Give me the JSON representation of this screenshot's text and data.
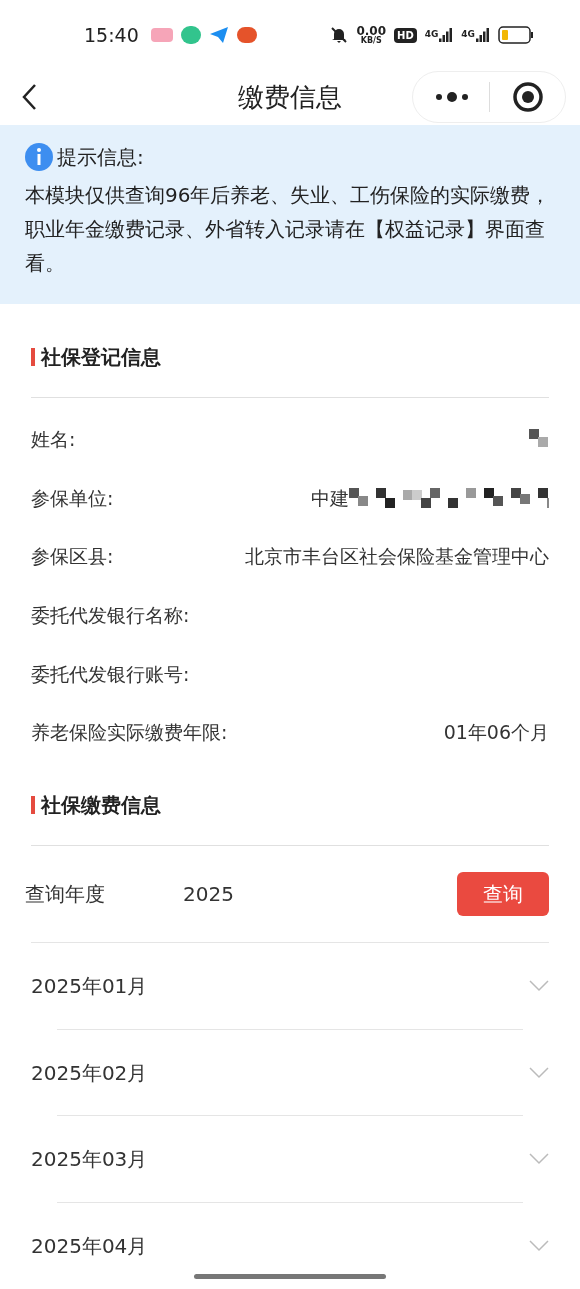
{
  "status_bar": {
    "time": "15:40",
    "speed": "0.00",
    "speed_unit": "KB/S",
    "hd": "HD",
    "networks": [
      "4G",
      "4G"
    ]
  },
  "header": {
    "title": "缴费信息"
  },
  "notice": {
    "title": "提示信息:",
    "text": "本模块仅供查询96年后养老、失业、工伤保险的实际缴费，职业年金缴费记录、外省转入记录请在【权益记录】界面查看。"
  },
  "registration": {
    "title": "社保登记信息",
    "rows": [
      {
        "label": "姓名:",
        "redacted": true
      },
      {
        "label": "参保单位:",
        "value": "中建",
        "redacted": true
      },
      {
        "label": "参保区县:",
        "value": "北京市丰台区社会保险基金管理中心",
        "redacted": false
      },
      {
        "label": "委托代发银行名称:",
        "redacted": false
      },
      {
        "label": "委托代发银行账号:",
        "redacted": false
      },
      {
        "label": "养老保险实际缴费年限:",
        "value": "01年06个月",
        "redacted": false
      }
    ]
  },
  "payment": {
    "title": "社保缴费信息",
    "query_label": "查询年度",
    "year": "2025",
    "query_button": "查询",
    "months": [
      {
        "label": "2025年01月",
        "expanded": false
      },
      {
        "label": "2025年02月",
        "expanded": false
      },
      {
        "label": "2025年03月",
        "expanded": false
      },
      {
        "label": "2025年04月",
        "expanded": false
      }
    ]
  }
}
